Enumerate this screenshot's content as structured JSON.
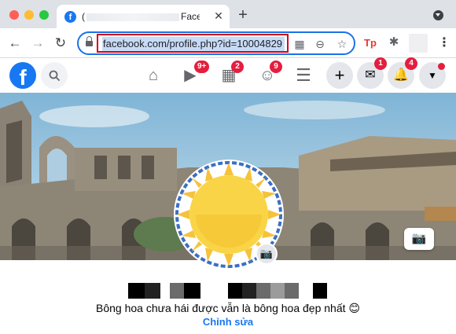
{
  "browser": {
    "tab": {
      "favicon": "f",
      "title_prefix": "(",
      "title_suffix": "Face",
      "close": "✕"
    },
    "new_tab": "+",
    "address_bar": {
      "url": "facebook.com/profile.php?id=10004829"
    },
    "icons": {
      "back": "←",
      "forward": "→",
      "reload": "↻",
      "qr": "▦",
      "zoom": "⊖",
      "star": "☆",
      "extension_tp": "Tp",
      "puzzle": "✱",
      "menu": "⋮"
    }
  },
  "facebook": {
    "logo": "f",
    "nav": {
      "home": "⌂",
      "watch": "▶",
      "watch_badge": "9+",
      "marketplace": "▦",
      "marketplace_badge": "2",
      "groups": "☺",
      "groups_badge": "9",
      "menu": "☰"
    },
    "actions": {
      "create": "+",
      "messenger": "✉",
      "messenger_badge": "1",
      "notifications": "🔔",
      "notifications_badge": "4",
      "account": "▼"
    },
    "cover_camera": "📷",
    "avatar_camera": "📷",
    "profile": {
      "bio": "Bông hoa chưa hái được vẫn là bông hoa đẹp nhất 😊",
      "edit_label": "Chỉnh sửa"
    }
  },
  "colors": {
    "brand": "#1877f2",
    "badge": "#e41e3f",
    "highlight_frame": "#d0021b",
    "url_selection": "#c7dbf8"
  }
}
